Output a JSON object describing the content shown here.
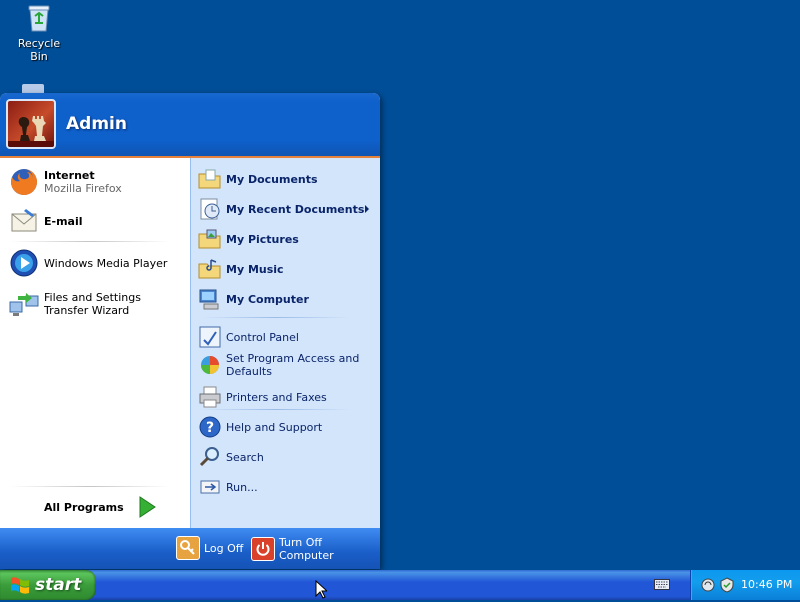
{
  "desktop": {
    "icons": [
      {
        "label": "Recycle Bin",
        "icon": "recycle-bin-icon"
      }
    ]
  },
  "start_menu": {
    "user_name": "Admin",
    "left": {
      "pinned": [
        {
          "title": "Internet",
          "subtitle": "Mozilla Firefox",
          "icon": "firefox-icon"
        },
        {
          "title": "E-mail",
          "icon": "email-icon"
        }
      ],
      "recent": [
        {
          "label": "Windows Media Player",
          "icon": "media-player-icon"
        },
        {
          "label": "Files and Settings Transfer Wizard",
          "icon": "transfer-wizard-icon"
        }
      ],
      "all_programs": "All Programs"
    },
    "right": {
      "places": [
        {
          "label": "My Documents",
          "icon": "folder-documents-icon"
        },
        {
          "label": "My Recent Documents",
          "icon": "recent-documents-icon",
          "has_submenu": true
        },
        {
          "label": "My Pictures",
          "icon": "folder-pictures-icon"
        },
        {
          "label": "My Music",
          "icon": "folder-music-icon"
        },
        {
          "label": "My Computer",
          "icon": "computer-icon"
        }
      ],
      "settings": [
        {
          "label": "Control Panel",
          "icon": "control-panel-icon"
        },
        {
          "label": "Set Program Access and Defaults",
          "icon": "program-access-icon"
        },
        {
          "label": "Printers and Faxes",
          "icon": "printer-icon"
        }
      ],
      "tools": [
        {
          "label": "Help and Support",
          "icon": "help-icon"
        },
        {
          "label": "Search",
          "icon": "search-icon"
        },
        {
          "label": "Run...",
          "icon": "run-icon"
        }
      ]
    },
    "footer": {
      "log_off": "Log Off",
      "turn_off": "Turn Off Computer"
    }
  },
  "taskbar": {
    "start_label": "start",
    "clock": "10:46 PM"
  },
  "colors": {
    "desktop": "#004e98",
    "header": "#0e60cb",
    "right_pane": "#d3e5fa",
    "start_green": "#3a9d3a",
    "tray": "#139ded"
  }
}
